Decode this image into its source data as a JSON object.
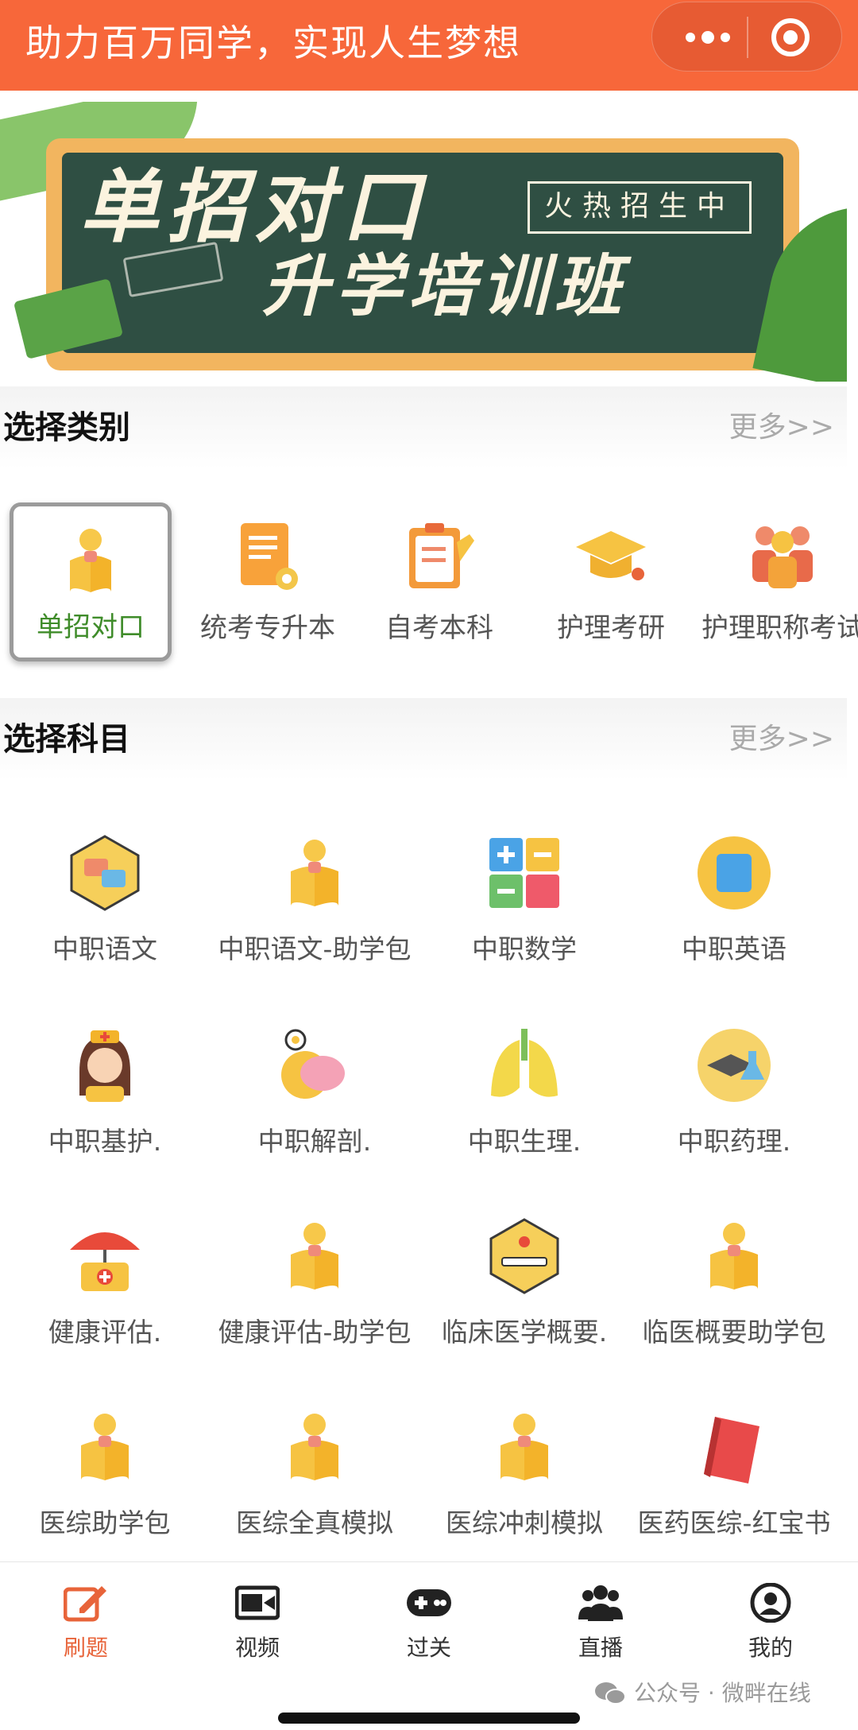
{
  "header": {
    "title": "助力百万同学，实现人生梦想",
    "background": "#f7673a"
  },
  "banner": {
    "line1": "单招对口",
    "tag": "火热招生中",
    "line2": "升学培训班"
  },
  "categories_section": {
    "title": "选择类别",
    "more": "更多>>",
    "items": [
      {
        "label": "单招对口",
        "icon": "reading-person-icon",
        "selected": true
      },
      {
        "label": "统考专升本",
        "icon": "certificate-icon",
        "selected": false
      },
      {
        "label": "自考本科",
        "icon": "clipboard-icon",
        "selected": false
      },
      {
        "label": "护理考研",
        "icon": "graduation-cap-icon",
        "selected": false
      },
      {
        "label": "护理职称考试",
        "icon": "group-icon",
        "selected": false
      }
    ]
  },
  "subjects_section": {
    "title": "选择科目",
    "more": "更多>>",
    "items": [
      {
        "label": "中职语文",
        "icon": "language-icon"
      },
      {
        "label": "中职语文-助学包",
        "icon": "reading-person-icon"
      },
      {
        "label": "中职数学",
        "icon": "calculator-icon"
      },
      {
        "label": "中职英语",
        "icon": "abcd-icon"
      },
      {
        "label": "中职基护.",
        "icon": "nurse-icon"
      },
      {
        "label": "中职解剖.",
        "icon": "brain-icon"
      },
      {
        "label": "中职生理.",
        "icon": "lungs-icon"
      },
      {
        "label": "中职药理.",
        "icon": "lab-cap-icon"
      },
      {
        "label": "健康评估.",
        "icon": "medical-umbrella-icon"
      },
      {
        "label": "健康评估-助学包",
        "icon": "reading-person-icon"
      },
      {
        "label": "临床医学概要.",
        "icon": "hospital-bed-icon"
      },
      {
        "label": "临医概要助学包",
        "icon": "reading-person-icon"
      },
      {
        "label": "医综助学包",
        "icon": "reading-person-icon"
      },
      {
        "label": "医综全真模拟",
        "icon": "reading-person-icon"
      },
      {
        "label": "医综冲刺模拟",
        "icon": "reading-person-icon"
      },
      {
        "label": "医药医综-红宝书",
        "icon": "red-book-icon"
      }
    ]
  },
  "tabbar": {
    "items": [
      {
        "label": "刷题",
        "icon": "edit-icon",
        "active": true
      },
      {
        "label": "视频",
        "icon": "video-icon",
        "active": false
      },
      {
        "label": "过关",
        "icon": "gamepad-icon",
        "active": false
      },
      {
        "label": "直播",
        "icon": "people-icon",
        "active": false
      },
      {
        "label": "我的",
        "icon": "profile-icon",
        "active": false
      }
    ],
    "active_color": "#e8643a"
  },
  "watermark": "公众号 · 微畔在线"
}
